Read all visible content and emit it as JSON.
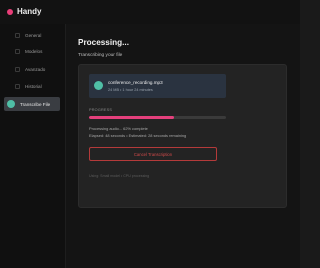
{
  "app": {
    "name": "Handy",
    "accent_color": "#ea3e79"
  },
  "sidebar": {
    "items": [
      {
        "label": "General",
        "icon": "general-icon",
        "active": false
      },
      {
        "label": "Modelos",
        "icon": "models-icon",
        "active": false
      },
      {
        "label": "Avanzado",
        "icon": "advanced-icon",
        "active": false
      },
      {
        "label": "Historial",
        "icon": "history-icon",
        "active": false
      },
      {
        "label": "Transcribe File",
        "icon": "transcribe-icon",
        "active": true
      }
    ]
  },
  "main": {
    "title": "Processing...",
    "subtitle": "Transcribing your file",
    "file": {
      "name": "conference_recording.mp3",
      "meta": "24 MB • 1 hour 24 minutes"
    },
    "progress": {
      "label": "PROGRESS",
      "percent": 62,
      "color": "#e4407c",
      "status": "Processing audio... 62% complete",
      "timing": "Elapsed: 48 seconds • Estimated: 28 seconds remaining"
    },
    "cancel_label": "Cancel Transcription",
    "footer_note": "Using: Small model • CPU processing"
  }
}
